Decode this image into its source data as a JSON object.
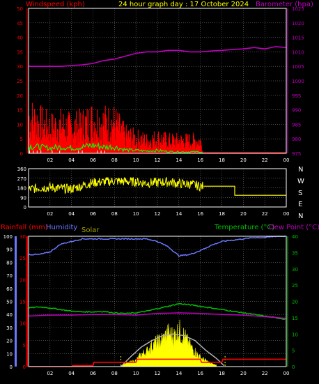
{
  "page_bg": "#000000",
  "top": {
    "title": "24 hour graph day : 17 October 2024",
    "left_label": "Windspeed (kph)",
    "right_label": "Barometer (hpa)",
    "colors": {
      "wind": "#ff0000",
      "gust": "#ff0000",
      "avg": "#00ff00",
      "calm": "#ffffff",
      "baro": "#c000c0",
      "frame": "#ffff00",
      "grid": "#8f8f8f"
    }
  },
  "middle": {
    "compass": [
      "N",
      "W",
      "S",
      "E",
      "N"
    ],
    "color": "#ffff00"
  },
  "bottom": {
    "rain_label": "Rainfall (mm)",
    "humidity_label": "Humidity",
    "solar_label": "Solar",
    "temp_label": "Temperature (°C)",
    "dew_label": "Dew Point (°C)",
    "colors": {
      "rain": "#ff0000",
      "humidity": "#6b78ff",
      "solar": "#ffff00",
      "solar_max": "#b0b0b0",
      "temp": "#00c000",
      "dew": "#c000c0"
    }
  },
  "chart_data": [
    {
      "type": "line",
      "name": "wind-barometer",
      "x_ticks": [
        "02",
        "04",
        "06",
        "08",
        "10",
        "12",
        "14",
        "16",
        "18",
        "20",
        "22",
        "00"
      ],
      "x_range_hours": [
        0,
        24
      ],
      "y_left_ticks": [
        "0",
        "5",
        "10",
        "15",
        "20",
        "25",
        "30",
        "35",
        "40",
        "45",
        "50"
      ],
      "y_left_range": [
        0,
        50
      ],
      "y_right_ticks": [
        "975",
        "980",
        "985",
        "990",
        "995",
        "1000",
        "1005",
        "1010",
        "1015",
        "1020",
        "1025"
      ],
      "y_right_range": [
        975,
        1025
      ],
      "grid": true,
      "series": [
        {
          "name": "Barometer (hpa)",
          "x": [
            0,
            3,
            5,
            6,
            7,
            8,
            9,
            10,
            11,
            12,
            13,
            14,
            15,
            16,
            17,
            18,
            19,
            20,
            21,
            22,
            23,
            24
          ],
          "y": [
            1005,
            1005,
            1005.5,
            1006,
            1007,
            1007.5,
            1008.5,
            1009.5,
            1010,
            1010,
            1010.5,
            1010.5,
            1010,
            1010,
            1010.3,
            1010.5,
            1010.8,
            1011,
            1011.5,
            1011,
            1011.8,
            1011.5
          ]
        },
        {
          "name": "Windspeed (kph)",
          "x": [
            0,
            1,
            2,
            3,
            4,
            5,
            6,
            7,
            8,
            9,
            10,
            11,
            12,
            13,
            14,
            15,
            16,
            16.3
          ],
          "y": [
            14,
            12,
            10,
            11,
            10,
            11,
            13,
            12,
            12,
            7,
            6,
            5,
            6,
            5,
            5,
            5,
            5,
            0
          ]
        },
        {
          "name": "Average speed",
          "x": [
            0,
            1,
            2,
            3,
            4,
            5,
            6,
            7,
            8,
            9,
            10,
            11,
            12,
            13,
            14,
            15,
            16,
            16.3
          ],
          "y": [
            2.5,
            2.2,
            1.8,
            2.2,
            1.8,
            2.2,
            2.8,
            2.2,
            2.2,
            1.2,
            1,
            0.8,
            1,
            0.6,
            0.5,
            0.5,
            0.5,
            0
          ]
        }
      ]
    },
    {
      "type": "scatter",
      "name": "wind-direction",
      "x_ticks": [
        "02",
        "04",
        "06",
        "08",
        "10",
        "12",
        "14",
        "16",
        "18",
        "20",
        "22",
        "00"
      ],
      "x_range_hours": [
        0,
        24
      ],
      "y_ticks": [
        "0",
        "90",
        "180",
        "270",
        "360"
      ],
      "y_range": [
        0,
        360
      ],
      "grid": true,
      "x": [
        0,
        1,
        2,
        3,
        4,
        5,
        6,
        7,
        8,
        9,
        10,
        11,
        12,
        13,
        14,
        15,
        16,
        16.3,
        19,
        19.2,
        24
      ],
      "y": [
        165,
        180,
        185,
        175,
        170,
        200,
        230,
        235,
        245,
        240,
        235,
        225,
        230,
        235,
        220,
        215,
        195,
        195,
        195,
        110,
        110
      ]
    },
    {
      "type": "line",
      "name": "temperature-humidity-solar-rain",
      "x_ticks": [
        "02",
        "04",
        "06",
        "08",
        "10",
        "12",
        "14",
        "16",
        "18",
        "20",
        "22",
        "00"
      ],
      "x_range_hours": [
        0,
        24
      ],
      "y_humidity_ticks": [
        "0",
        "10",
        "20",
        "30",
        "40",
        "50",
        "60",
        "70",
        "80",
        "90",
        "100"
      ],
      "y_rain_ticks": [
        "0",
        "5",
        "10",
        "15",
        "20",
        "25",
        "30"
      ],
      "y_temp_ticks": [
        "0",
        "5",
        "10",
        "15",
        "20",
        "25",
        "30",
        "35",
        "40"
      ],
      "grid": true,
      "series": [
        {
          "name": "Humidity",
          "x": [
            0,
            1,
            2,
            3,
            4,
            5,
            6,
            7,
            8,
            9,
            10,
            11,
            12,
            13,
            14,
            15,
            16,
            17,
            18,
            19,
            20,
            21,
            22,
            23,
            24
          ],
          "y": [
            86,
            86,
            88,
            94,
            96,
            98,
            98,
            98,
            98,
            98,
            98,
            98,
            96,
            92,
            85,
            86,
            89,
            93,
            96,
            97,
            98,
            99,
            99,
            100,
            100
          ]
        },
        {
          "name": "Temperature (°C)",
          "x": [
            0,
            1,
            2,
            3,
            4,
            5,
            6,
            7,
            8,
            9,
            10,
            11,
            12,
            13,
            14,
            15,
            16,
            17,
            18,
            19,
            20,
            21,
            22,
            23,
            24
          ],
          "y": [
            18,
            18.3,
            18,
            17.5,
            17,
            16.8,
            16.8,
            16.9,
            16.5,
            16.3,
            16.5,
            17,
            17.8,
            18.5,
            19.3,
            19,
            18.5,
            18,
            17.5,
            17,
            16.5,
            16,
            15.5,
            15,
            14.5
          ]
        },
        {
          "name": "Dew Point (°C)",
          "x": [
            0,
            2,
            4,
            6,
            8,
            10,
            12,
            14,
            16,
            18,
            20,
            22,
            24
          ],
          "y": [
            15.5,
            15.8,
            15.8,
            16,
            16,
            15.8,
            16.3,
            16.5,
            16.3,
            16,
            15.8,
            15.3,
            14.8
          ]
        },
        {
          "name": "Solar",
          "x": [
            8.6,
            9.5,
            10,
            10.5,
            11,
            11.5,
            12,
            12.5,
            13,
            13.5,
            14,
            14.5,
            15,
            15.5,
            16,
            17,
            17.5
          ],
          "y": [
            0.5,
            1.5,
            2,
            4,
            5,
            7,
            8,
            9,
            11,
            10,
            12,
            10,
            7,
            5,
            3,
            1,
            0.5
          ]
        },
        {
          "name": "Solar max",
          "x": [
            8.6,
            9.5,
            10.5,
            11.5,
            12.5,
            13.5,
            14.5,
            15.5,
            16.5,
            17.5,
            18.3
          ],
          "y": [
            0,
            3,
            6,
            8,
            9.5,
            10,
            9.5,
            8,
            5,
            2.5,
            0
          ]
        },
        {
          "name": "Rainfall (mm)",
          "x": [
            0,
            4,
            4.1,
            6,
            6.1,
            10,
            10.1,
            16,
            16.1,
            18,
            18.1,
            24
          ],
          "y": [
            0,
            0,
            0.2,
            0.2,
            1.0,
            1.0,
            1.7,
            1.7,
            1.0,
            1.0,
            1.7,
            1.7
          ]
        }
      ]
    }
  ]
}
